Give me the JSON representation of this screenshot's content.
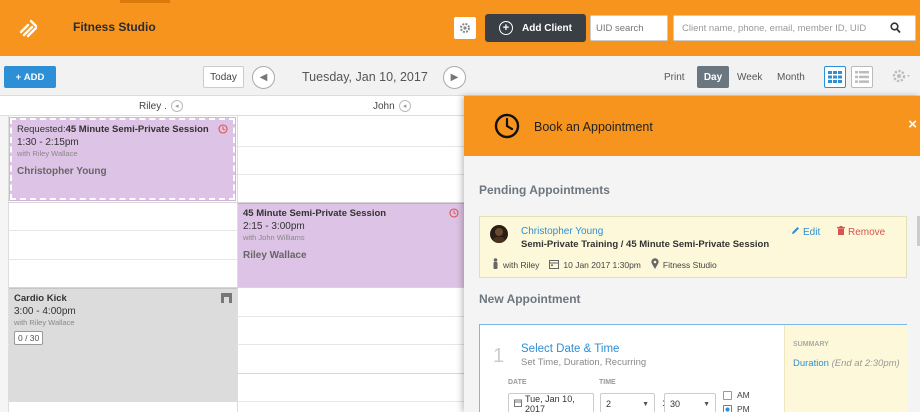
{
  "header": {
    "studio_name": "Fitness Studio",
    "add_client_label": "Add Client",
    "uid_placeholder": "UID search",
    "client_search_placeholder": "Client name, phone, email, member ID, UID"
  },
  "toolbar": {
    "add_label": "ADD",
    "today_label": "Today",
    "date": "Tuesday, Jan 10, 2017",
    "views": {
      "print": "Print",
      "day": "Day",
      "week": "Week",
      "month": "Month"
    }
  },
  "columns": [
    {
      "name": "Riley ."
    },
    {
      "name": "John"
    }
  ],
  "events": [
    {
      "prefix": "Requested:",
      "title": "45 Minute Semi-Private Session",
      "time": "1:30 - 2:15pm",
      "with": "with Riley Wallace",
      "client": "Christopher Young"
    },
    {
      "title": "45 Minute Semi-Private Session",
      "time": "2:15 - 3:00pm",
      "with": "with John Williams",
      "client": "Riley Wallace"
    },
    {
      "title": "Cardio Kick",
      "time": "3:00 - 4:00pm",
      "with": "with Riley Wallace",
      "capacity": "0 / 30"
    }
  ],
  "panel": {
    "title": "Book an Appointment",
    "close": "×",
    "pending_heading": "Pending Appointments",
    "pending": {
      "client": "Christopher Young",
      "service": "Semi-Private Training / 45 Minute Semi-Private Session",
      "with": "with Riley",
      "datetime": "10 Jan 2017 1:30pm",
      "location": "Fitness Studio",
      "edit": "Edit",
      "remove": "Remove"
    },
    "new_heading": "New Appointment",
    "step": {
      "number": "1",
      "title": "Select Date & Time",
      "subtitle": "Set Time, Duration, Recurring",
      "date_label": "DATE",
      "time_label": "TIME",
      "date_value": "Tue, Jan 10, 2017",
      "hour": "2",
      "minute": "30",
      "am": "AM",
      "pm": "PM",
      "selected_period": "PM"
    },
    "summary": {
      "label": "SUMMARY",
      "duration": "Duration",
      "end": "(End at 2:30pm)"
    }
  },
  "colors": {
    "brand": "#f7941d",
    "accent_blue": "#2d8fd5",
    "event_purple": "#ddc3e5",
    "class_gray": "#dcdcdc",
    "pending_bg": "#fdf8da"
  }
}
